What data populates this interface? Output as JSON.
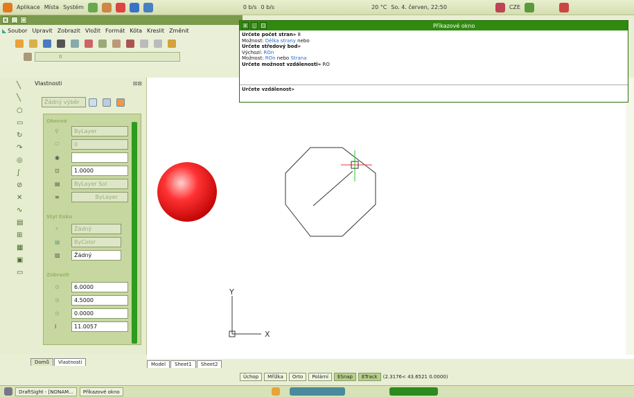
{
  "toppanel": {
    "menu_apps": "Aplikace",
    "menu_places": "Místa",
    "menu_system": "Systém",
    "net_down": "0 b/s",
    "net_up": "0 b/s",
    "weather": "20 °C",
    "datetime": "So.  4. červen, 22:50",
    "keyboard": "CZE"
  },
  "menu": [
    "Soubor",
    "Upravit",
    "Zobrazit",
    "Vložit",
    "Formát",
    "Kóta",
    "Kreslit",
    "Změnit"
  ],
  "toolbar2": {
    "layer": "0"
  },
  "props": {
    "title": "Vlastnosti",
    "selection": "Žádný výběr",
    "section_general": "Obecné",
    "color": "ByLayer",
    "layer": "0",
    "linetype_scale": "1.0000",
    "lineweight": "ByLayer  Sol",
    "linetype": "ByLayer",
    "section_print": "Styl tisku",
    "print_style": "Žádný",
    "print_color": "ByColor",
    "print_table": "Žádný",
    "section_view": "Zobrazit",
    "center_x": "6.0000",
    "center_y": "4.5000",
    "center_z": "0.0000",
    "height": "11.0057"
  },
  "panel_tabs": {
    "home": "Domů",
    "props": "Vlastnosti"
  },
  "cmd": {
    "title": "Příkazové okno",
    "l1": "Určete počet stran»",
    "l1v": " 8",
    "l2a": "Možnost: ",
    "l2b": "Délka strany",
    "l2c": " nebo",
    "l3": "Určete středový bod»",
    "l4a": "Výchozí: ",
    "l4b": "ROn",
    "l5a": "Možnost: ",
    "l5b": "ROn",
    "l5c": " nebo ",
    "l5d": "Strana",
    "l6": "Určete možnost vzdálenosti»",
    "l6v": " RO",
    "prompt": "Určete vzdálenost»"
  },
  "tabs": {
    "model": "Model",
    "sheet1": "Sheet1",
    "sheet2": "Sheet2"
  },
  "status": {
    "uchop": "Úchop",
    "mrizka": "Mřížka",
    "orto": "Orto",
    "polarni": "Polární",
    "esnap": "ESnap",
    "etrack": "ETrack",
    "coords": "(2.3176< 43.6521 0.0000)"
  },
  "axes": {
    "x": "X",
    "y": "Y"
  },
  "taskbar": {
    "t1": "DraftSight - [NONAM...",
    "t2": "Příkazové okno"
  }
}
